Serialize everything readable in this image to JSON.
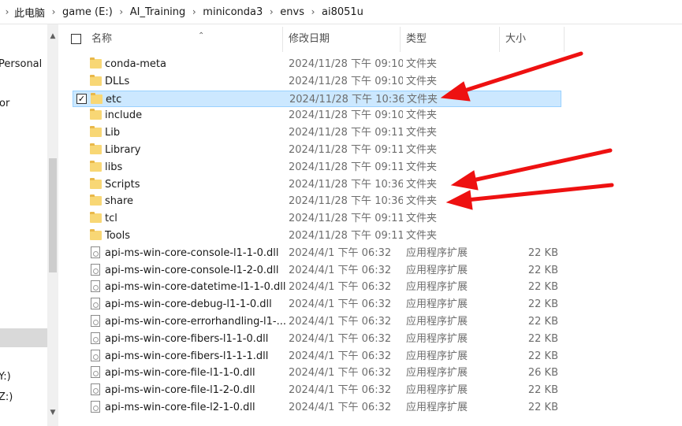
{
  "breadcrumb": [
    "此电脑",
    "game (E:)",
    "AI_Training",
    "miniconda3",
    "envs",
    "ai8051u"
  ],
  "nav": {
    "items": [
      "Personal",
      "or",
      "Y:)",
      "Z:)"
    ]
  },
  "columns": {
    "name": "名称",
    "date": "修改日期",
    "type": "类型",
    "size": "大小"
  },
  "files": [
    {
      "name": "conda-meta",
      "date": "2024/11/28 下午 09:10",
      "type": "文件夹",
      "size": "",
      "kind": "folder",
      "selected": false
    },
    {
      "name": "DLLs",
      "date": "2024/11/28 下午 09:10",
      "type": "文件夹",
      "size": "",
      "kind": "folder",
      "selected": false
    },
    {
      "name": "etc",
      "date": "2024/11/28 下午 10:36",
      "type": "文件夹",
      "size": "",
      "kind": "folder",
      "selected": true
    },
    {
      "name": "include",
      "date": "2024/11/28 下午 09:10",
      "type": "文件夹",
      "size": "",
      "kind": "folder",
      "selected": false
    },
    {
      "name": "Lib",
      "date": "2024/11/28 下午 09:11",
      "type": "文件夹",
      "size": "",
      "kind": "folder",
      "selected": false
    },
    {
      "name": "Library",
      "date": "2024/11/28 下午 09:11",
      "type": "文件夹",
      "size": "",
      "kind": "folder",
      "selected": false
    },
    {
      "name": "libs",
      "date": "2024/11/28 下午 09:11",
      "type": "文件夹",
      "size": "",
      "kind": "folder",
      "selected": false
    },
    {
      "name": "Scripts",
      "date": "2024/11/28 下午 10:36",
      "type": "文件夹",
      "size": "",
      "kind": "folder",
      "selected": false
    },
    {
      "name": "share",
      "date": "2024/11/28 下午 10:36",
      "type": "文件夹",
      "size": "",
      "kind": "folder",
      "selected": false
    },
    {
      "name": "tcl",
      "date": "2024/11/28 下午 09:11",
      "type": "文件夹",
      "size": "",
      "kind": "folder",
      "selected": false
    },
    {
      "name": "Tools",
      "date": "2024/11/28 下午 09:11",
      "type": "文件夹",
      "size": "",
      "kind": "folder",
      "selected": false
    },
    {
      "name": "api-ms-win-core-console-l1-1-0.dll",
      "date": "2024/4/1 下午 06:32",
      "type": "应用程序扩展",
      "size": "22 KB",
      "kind": "dll",
      "selected": false
    },
    {
      "name": "api-ms-win-core-console-l1-2-0.dll",
      "date": "2024/4/1 下午 06:32",
      "type": "应用程序扩展",
      "size": "22 KB",
      "kind": "dll",
      "selected": false
    },
    {
      "name": "api-ms-win-core-datetime-l1-1-0.dll",
      "date": "2024/4/1 下午 06:32",
      "type": "应用程序扩展",
      "size": "22 KB",
      "kind": "dll",
      "selected": false
    },
    {
      "name": "api-ms-win-core-debug-l1-1-0.dll",
      "date": "2024/4/1 下午 06:32",
      "type": "应用程序扩展",
      "size": "22 KB",
      "kind": "dll",
      "selected": false
    },
    {
      "name": "api-ms-win-core-errorhandling-l1-...",
      "date": "2024/4/1 下午 06:32",
      "type": "应用程序扩展",
      "size": "22 KB",
      "kind": "dll",
      "selected": false
    },
    {
      "name": "api-ms-win-core-fibers-l1-1-0.dll",
      "date": "2024/4/1 下午 06:32",
      "type": "应用程序扩展",
      "size": "22 KB",
      "kind": "dll",
      "selected": false
    },
    {
      "name": "api-ms-win-core-fibers-l1-1-1.dll",
      "date": "2024/4/1 下午 06:32",
      "type": "应用程序扩展",
      "size": "22 KB",
      "kind": "dll",
      "selected": false
    },
    {
      "name": "api-ms-win-core-file-l1-1-0.dll",
      "date": "2024/4/1 下午 06:32",
      "type": "应用程序扩展",
      "size": "26 KB",
      "kind": "dll",
      "selected": false
    },
    {
      "name": "api-ms-win-core-file-l1-2-0.dll",
      "date": "2024/4/1 下午 06:32",
      "type": "应用程序扩展",
      "size": "22 KB",
      "kind": "dll",
      "selected": false
    },
    {
      "name": "api-ms-win-core-file-l2-1-0.dll",
      "date": "2024/4/1 下午 06:32",
      "type": "应用程序扩展",
      "size": "22 KB",
      "kind": "dll",
      "selected": false
    }
  ],
  "icons": {
    "folder": "folder-icon",
    "dll": "dll-file-icon",
    "sort": "sort-up-icon",
    "separator": "chevron-right-icon"
  },
  "colors": {
    "selection_bg": "#cce8ff",
    "selection_border": "#99d1ff",
    "annotation_arrow": "#ee1111"
  }
}
